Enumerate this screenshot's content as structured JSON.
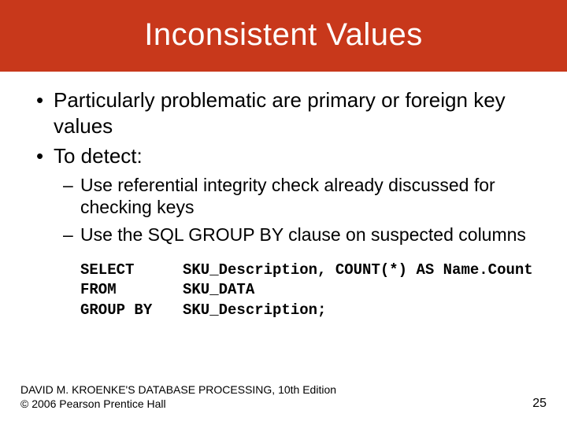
{
  "slide": {
    "title": "Inconsistent Values",
    "bullets": [
      "Particularly problematic are primary or foreign key values",
      "To detect:"
    ],
    "sub_bullets": [
      "Use referential integrity check already discussed for checking keys",
      "Use the SQL GROUP BY clause on suspected columns"
    ],
    "sql": {
      "lines": [
        {
          "keyword": "SELECT",
          "rest": "SKU_Description, COUNT(*) AS Name.Count"
        },
        {
          "keyword": "FROM",
          "rest": "SKU_DATA"
        },
        {
          "keyword": "GROUP BY",
          "rest": "SKU_Description;"
        }
      ]
    }
  },
  "footer": {
    "line1": "DAVID M. KROENKE'S DATABASE PROCESSING, 10th Edition",
    "line2": "© 2006 Pearson Prentice Hall",
    "page_number": "25"
  }
}
